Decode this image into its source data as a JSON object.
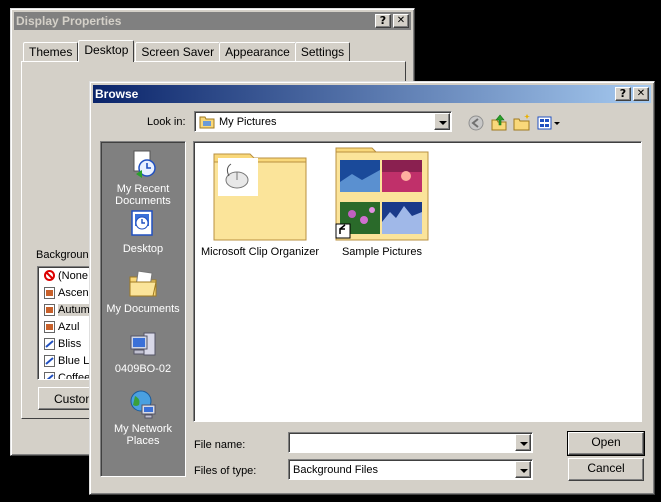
{
  "display_properties": {
    "title": "Display Properties",
    "help_label": "?",
    "close_label": "✕",
    "tabs": [
      "Themes",
      "Desktop",
      "Screen Saver",
      "Appearance",
      "Settings"
    ],
    "active_tab": "Desktop",
    "background_label": "Backgroun",
    "backgrounds": [
      "(None",
      "Ascen",
      "Autum",
      "Azul",
      "Bliss",
      "Blue L",
      "Coffee"
    ],
    "customize_label": "Customi"
  },
  "browse": {
    "title": "Browse",
    "help_label": "?",
    "close_label": "✕",
    "look_in_label": "Look in:",
    "look_in_value": "My Pictures",
    "places": [
      {
        "label": "My Recent Documents",
        "icon": "recent-documents-icon"
      },
      {
        "label": "Desktop",
        "icon": "desktop-icon"
      },
      {
        "label": "My Documents",
        "icon": "my-documents-icon"
      },
      {
        "label": "0409BO-02",
        "icon": "my-computer-icon"
      },
      {
        "label": "My Network Places",
        "icon": "network-places-icon"
      }
    ],
    "files": [
      {
        "label": "Microsoft Clip Organizer",
        "icon": "folder-mouse-icon"
      },
      {
        "label": "Sample Pictures",
        "icon": "folder-pictures-shortcut-icon"
      }
    ],
    "file_name_label": "File name:",
    "file_name_value": "",
    "files_of_type_label": "Files of type:",
    "files_of_type_value": "Background Files",
    "open_label": "Open",
    "cancel_label": "Cancel"
  },
  "colors": {
    "active_title_start": "#0a246a",
    "active_title_end": "#a6caf0",
    "inactive_title": "#808080",
    "face": "#d4d0c8",
    "places_bar": "#808080",
    "folder": "#f9d87a"
  }
}
